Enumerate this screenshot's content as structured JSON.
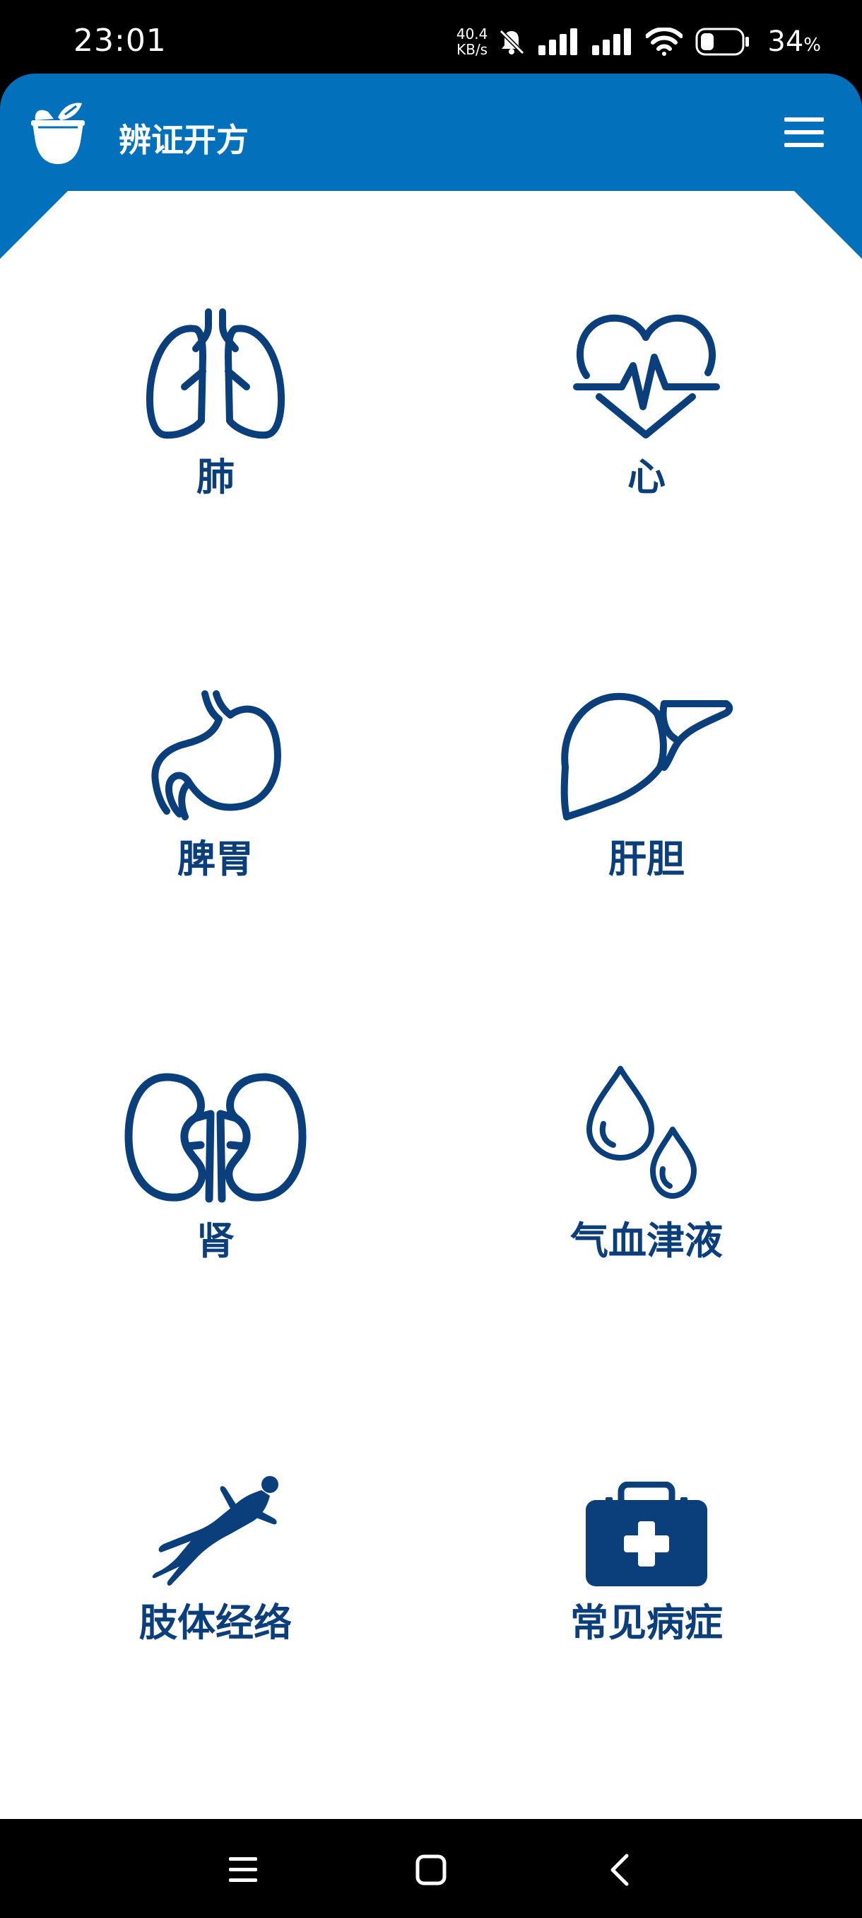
{
  "status_bar": {
    "time": "23:01",
    "net_speed_value": "40.4",
    "net_speed_unit": "KB/s",
    "battery_percent": "34",
    "battery_sign": "%",
    "battery_level": 0.34
  },
  "app_bar": {
    "title": "辨证开方",
    "logo_icon": "mortar-herb-icon",
    "menu_icon": "hamburger-menu-icon"
  },
  "categories": [
    {
      "label": "肺",
      "icon": "lungs-icon"
    },
    {
      "label": "心",
      "icon": "heart-pulse-icon"
    },
    {
      "label": "脾胃",
      "icon": "stomach-icon"
    },
    {
      "label": "肝胆",
      "icon": "liver-icon"
    },
    {
      "label": "肾",
      "icon": "kidneys-icon"
    },
    {
      "label": "气血津液",
      "icon": "water-drops-icon"
    },
    {
      "label": "肢体经络",
      "icon": "human-body-icon"
    },
    {
      "label": "常见病症",
      "icon": "first-aid-kit-icon"
    }
  ],
  "colors": {
    "brand_blue": "#0270bb",
    "icon_navy": "#0a3f7c",
    "background": "#ffffff"
  },
  "nav_bar": {
    "recent_icon": "recent-apps-icon",
    "home_icon": "home-icon",
    "back_icon": "back-icon"
  }
}
